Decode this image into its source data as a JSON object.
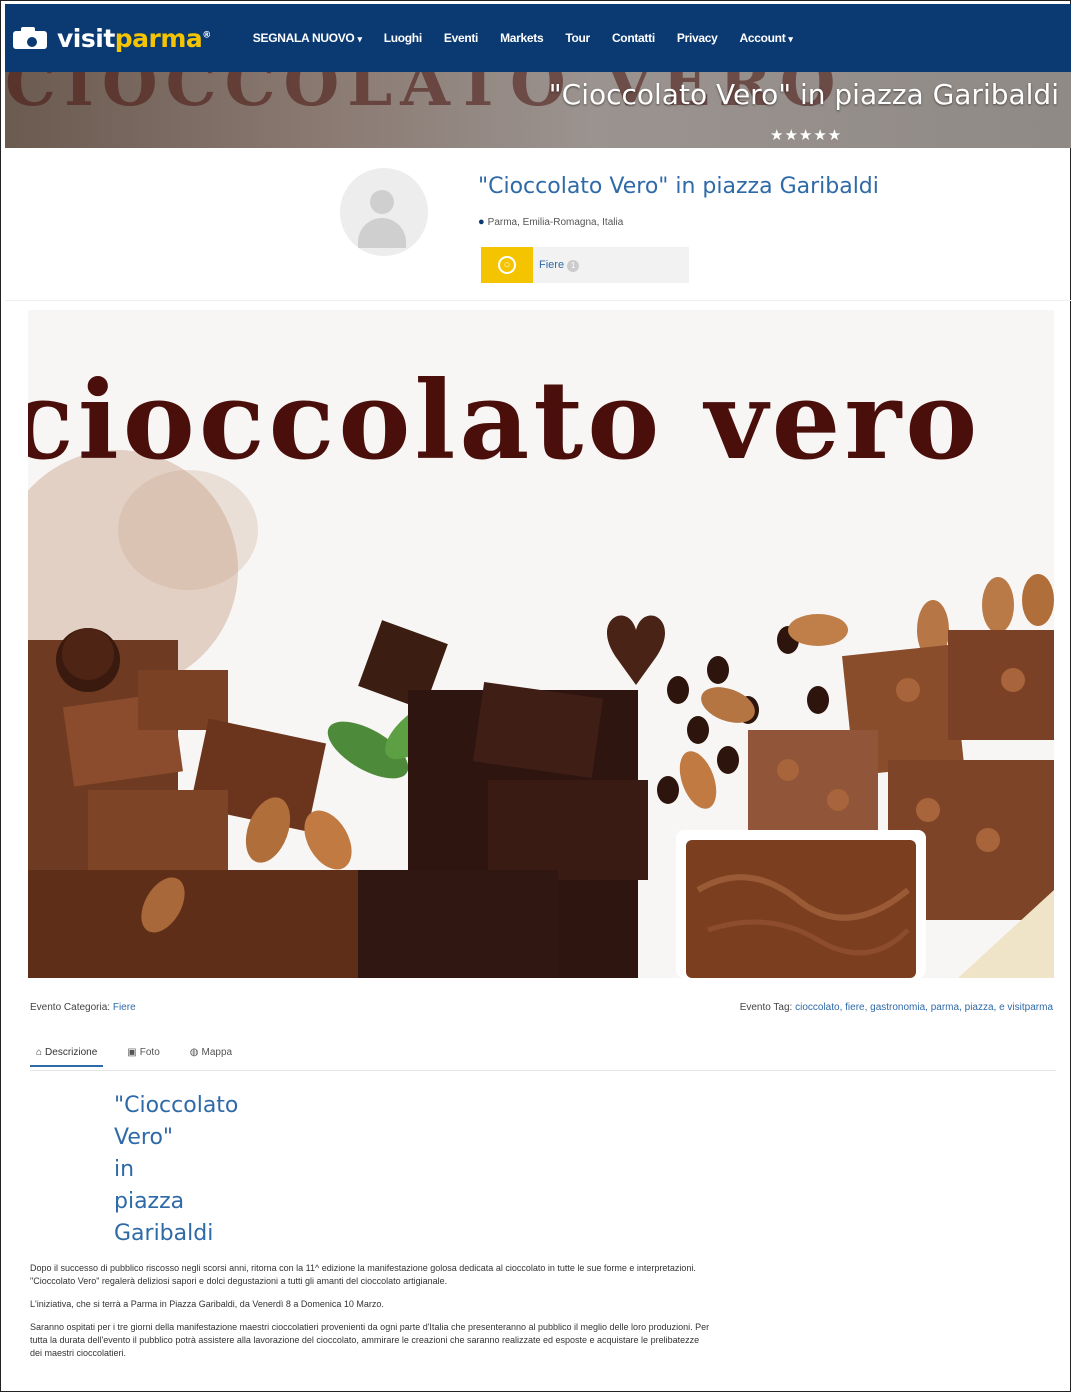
{
  "brand": {
    "visit": "visit",
    "parma": "parma",
    "mark": "®"
  },
  "nav": {
    "items": [
      {
        "label": "SEGNALA NUOVO",
        "dropdown": true
      },
      {
        "label": "Luoghi"
      },
      {
        "label": "Eventi"
      },
      {
        "label": "Markets"
      },
      {
        "label": "Tour"
      },
      {
        "label": "Contatti"
      },
      {
        "label": "Privacy"
      },
      {
        "label": "Account",
        "dropdown": true
      }
    ],
    "caret": "▾"
  },
  "hero": {
    "title": "\"Cioccolato Vero\" in piazza Garibaldi",
    "rating_stars": "★★★★★",
    "background_text": "CIOCCOLATO VERO"
  },
  "event": {
    "title": "\"Cioccolato Vero\" in piazza Garibaldi",
    "location": "Parma, Emilia-Romagna, Italia",
    "category_label": "Fiere",
    "category_count": "1"
  },
  "image": {
    "headline": "cioccolato vero"
  },
  "meta": {
    "category_prefix": "Evento Categoria:",
    "category_value": "Fiere",
    "tag_prefix": "Evento Tag:",
    "tags": "cioccolato, fiere, gastronomia, parma, piazza, e visitparma"
  },
  "tabs": [
    {
      "label": "Descrizione",
      "icon": "home-icon",
      "active": true
    },
    {
      "label": "Foto",
      "icon": "camera-icon",
      "active": false
    },
    {
      "label": "Mappa",
      "icon": "globe-icon",
      "active": false
    }
  ],
  "description": {
    "title_lines": [
      "\"Cioccolato",
      "Vero\"",
      "in",
      "piazza",
      "Garibaldi"
    ],
    "paragraphs": [
      "Dopo il successo di pubblico riscosso negli scorsi anni, ritorna con la 11^ edizione la manifestazione golosa dedicata al cioccolato in tutte le sue forme e interpretazioni. \"Cioccolato Vero\" regalerà deliziosi sapori e dolci degustazioni a tutti gli amanti del cioccolato artigianale.",
      "L'iniziativa, che si terrà a Parma in Piazza Garibaldi, da Venerdì 8 a Domenica 10 Marzo.",
      "Saranno ospitati per i tre giorni della manifestazione maestri cioccolatieri provenienti da ogni parte d'Italia che presenteranno al pubblico il meglio delle loro produzioni. Per tutta la durata dell'evento il pubblico potrà assistere alla lavorazione del cioccolato, ammirare le creazioni che saranno realizzate ed esposte e acquistare le prelibatezze dei maestri cioccolatieri."
    ]
  },
  "colors": {
    "navbar": "#0b3a73",
    "accent_yellow": "#f5c400",
    "link_blue": "#2f6aa8",
    "chocolate_text": "#4a0e0b"
  }
}
